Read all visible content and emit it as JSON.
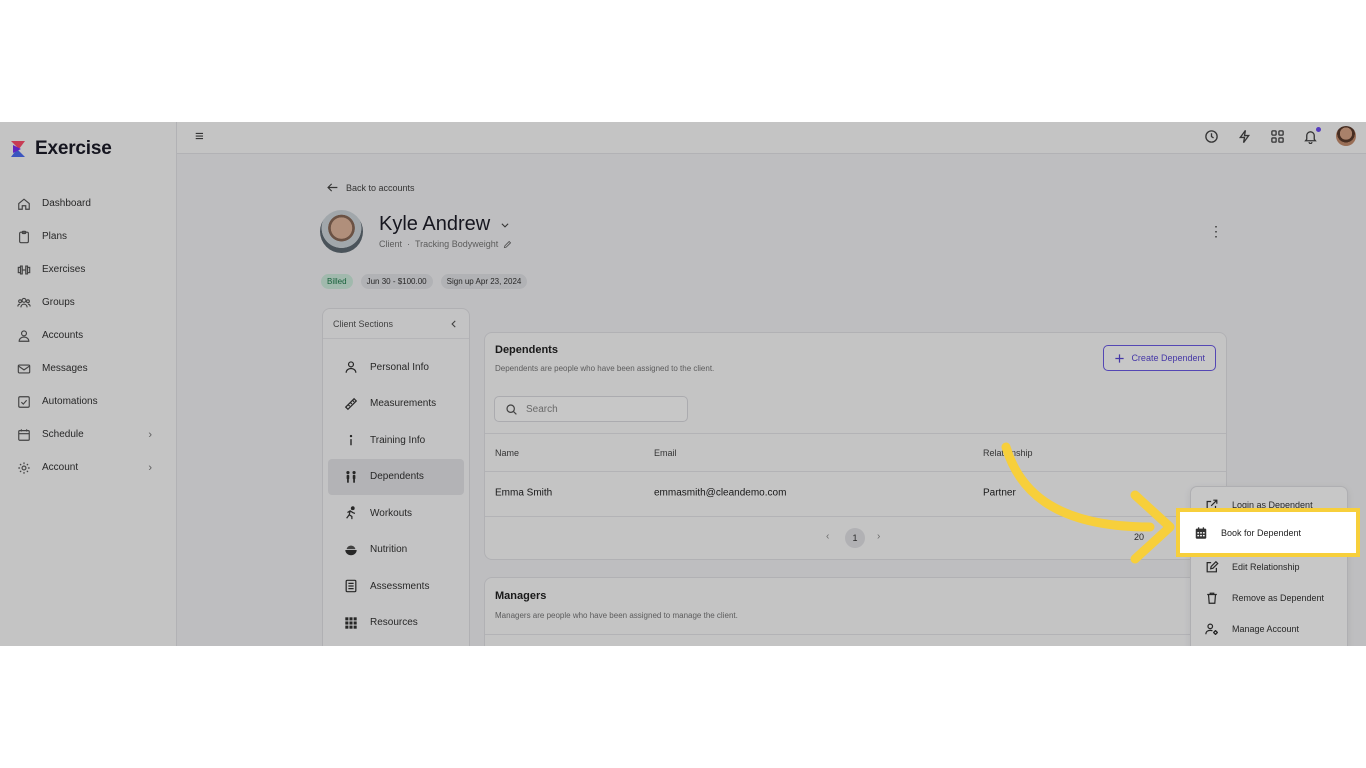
{
  "app": {
    "name": "Exercise"
  },
  "sidebar": {
    "items": [
      {
        "label": "Dashboard",
        "icon": "home-icon"
      },
      {
        "label": "Plans",
        "icon": "clipboard-icon"
      },
      {
        "label": "Exercises",
        "icon": "dumbbell-icon"
      },
      {
        "label": "Groups",
        "icon": "users-icon"
      },
      {
        "label": "Accounts",
        "icon": "user-icon"
      },
      {
        "label": "Messages",
        "icon": "mail-icon"
      },
      {
        "label": "Automations",
        "icon": "checkbox-icon"
      },
      {
        "label": "Schedule",
        "icon": "calendar-icon",
        "chevron": "›"
      },
      {
        "label": "Account",
        "icon": "gear-icon",
        "chevron": "›"
      }
    ]
  },
  "topbar": {
    "menu_icon": "≡"
  },
  "back": {
    "label": "Back to accounts"
  },
  "profile": {
    "name": "Kyle Andrew",
    "role": "Client",
    "separator": "·",
    "tracking": "Tracking Bodyweight",
    "badges": [
      "Billed",
      "Jun 30 - $100.00",
      "Sign up Apr 23, 2024"
    ]
  },
  "client_sections": {
    "title": "Client Sections",
    "items": [
      {
        "label": "Personal Info",
        "icon": "person-icon"
      },
      {
        "label": "Measurements",
        "icon": "ruler-icon"
      },
      {
        "label": "Training Info",
        "icon": "info-icon"
      },
      {
        "label": "Dependents",
        "icon": "dependents-icon",
        "active": true
      },
      {
        "label": "Workouts",
        "icon": "running-icon"
      },
      {
        "label": "Nutrition",
        "icon": "bowl-icon"
      },
      {
        "label": "Assessments",
        "icon": "assessment-icon"
      },
      {
        "label": "Resources",
        "icon": "grid-icon"
      }
    ]
  },
  "dependents": {
    "title": "Dependents",
    "subtitle": "Dependents are people who have been assigned to the client.",
    "create_label": "Create Dependent",
    "search_placeholder": "Search",
    "columns": [
      "Name",
      "Email",
      "Relationship"
    ],
    "rows": [
      {
        "name": "Emma Smith",
        "email": "emmasmith@cleandemo.com",
        "relationship": "Partner"
      }
    ],
    "page": "1",
    "page_size": "20"
  },
  "managers": {
    "title": "Managers",
    "subtitle": "Managers are people who have been assigned to manage the client."
  },
  "context_menu": {
    "items": [
      {
        "label": "Login as Dependent",
        "icon": "external-link-icon"
      },
      {
        "label": "Book for Dependent",
        "icon": "calendar-icon",
        "highlighted": true
      },
      {
        "label": "Edit Relationship",
        "icon": "edit-icon"
      },
      {
        "label": "Remove as Dependent",
        "icon": "trash-icon"
      },
      {
        "label": "Manage Account",
        "icon": "user-gear-icon"
      }
    ]
  },
  "colors": {
    "accent": "#6c5ce7",
    "highlight": "#f7cf3b",
    "billed": "#1c7a4a"
  }
}
